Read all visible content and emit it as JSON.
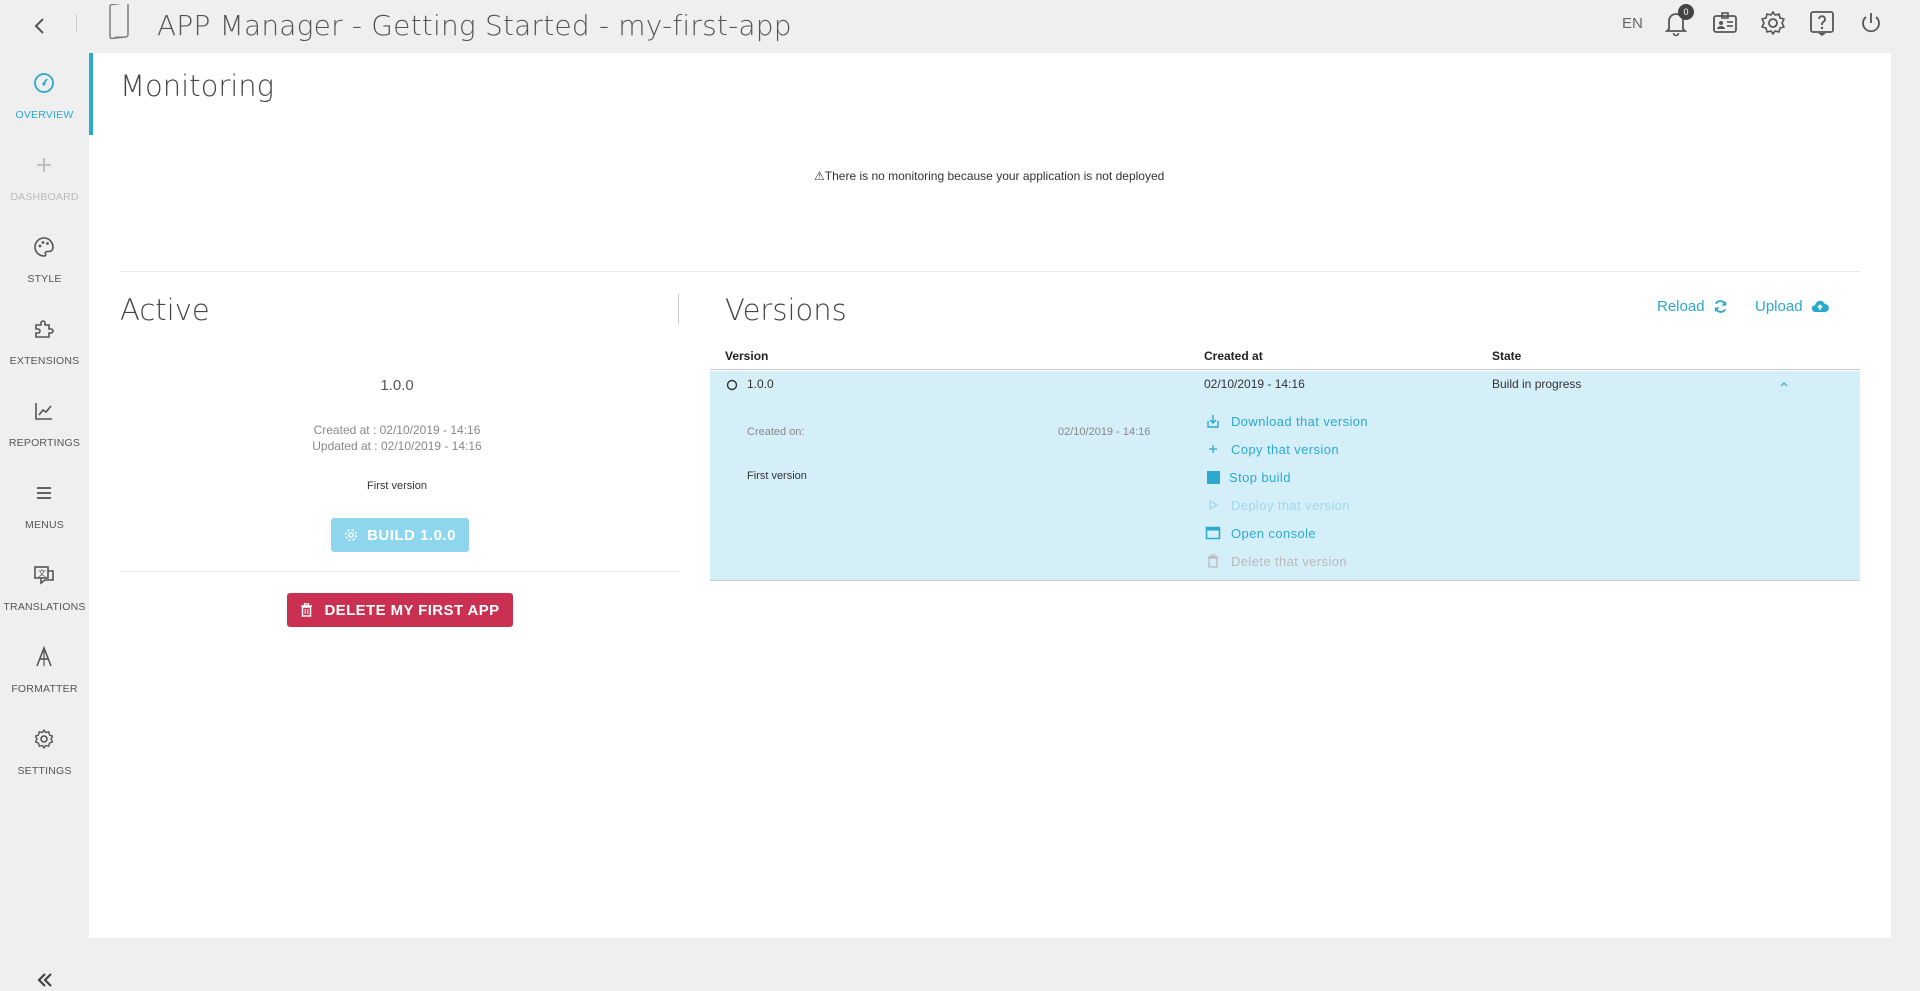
{
  "header": {
    "title": "APP Manager - Getting Started - my-first-app",
    "lang": "EN",
    "notification_count": "0"
  },
  "sidebar": {
    "items": [
      {
        "label": "OVERVIEW",
        "icon": "gauge-icon"
      },
      {
        "label": "DASHBOARD",
        "icon": "plus-icon"
      },
      {
        "label": "STYLE",
        "icon": "palette-icon"
      },
      {
        "label": "EXTENSIONS",
        "icon": "puzzle-icon"
      },
      {
        "label": "REPORTINGS",
        "icon": "line-chart-icon"
      },
      {
        "label": "MENUS",
        "icon": "hamburger-icon"
      },
      {
        "label": "TRANSLATIONS",
        "icon": "translate-icon"
      },
      {
        "label": "FORMATTER",
        "icon": "formatter-icon"
      },
      {
        "label": "SETTINGS",
        "icon": "gear-icon"
      }
    ]
  },
  "monitoring": {
    "title": "Monitoring",
    "message": "There is no monitoring because your application is not deployed"
  },
  "active": {
    "title": "Active",
    "version": "1.0.0",
    "created_at": "Created at  : 02/10/2019 - 14:16",
    "updated_at": "Updated at : 02/10/2019 - 14:16",
    "description": "First version",
    "build_label": "BUILD 1.0.0",
    "delete_label": "DELETE MY FIRST APP"
  },
  "versions": {
    "title": "Versions",
    "reload_label": "Reload",
    "upload_label": "Upload",
    "columns": [
      "Version",
      "Created at",
      "State"
    ],
    "rows": [
      {
        "version": "1.0.0",
        "created_at": "02/10/2019 - 14:16",
        "state": "Build in progress",
        "created_on_label": "Created on:",
        "created_on_value": "02/10/2019 - 14:16",
        "description": "First version",
        "actions": [
          {
            "label": "Download that version",
            "icon": "download-icon"
          },
          {
            "label": "Copy that version",
            "icon": "plus-icon"
          },
          {
            "label": "Stop build",
            "icon": "stop-icon"
          },
          {
            "label": "Deploy that version",
            "icon": "play-icon"
          },
          {
            "label": "Open console",
            "icon": "console-icon"
          },
          {
            "label": "Delete that version",
            "icon": "trash-icon"
          }
        ]
      }
    ]
  },
  "colors": {
    "accent": "#2ba9cf",
    "danger": "#c93052",
    "row_highlight": "#d5eff9"
  }
}
